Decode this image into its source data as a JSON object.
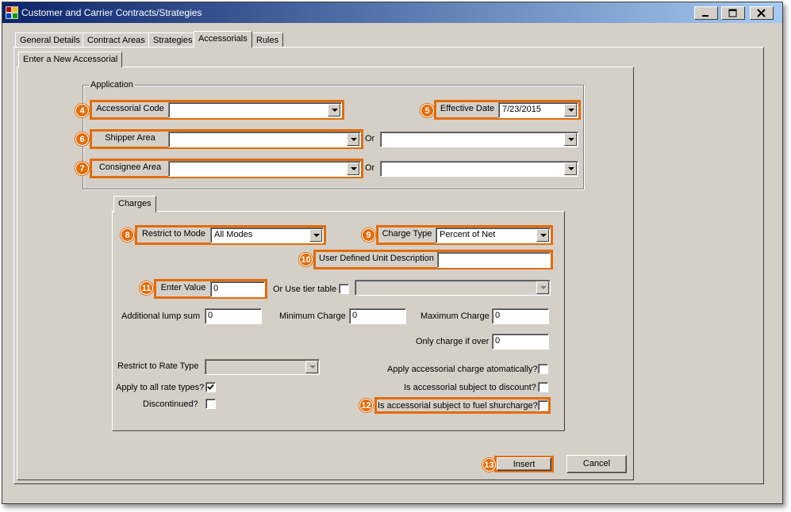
{
  "window": {
    "title": "Customer and Carrier Contracts/Strategies"
  },
  "tabs": [
    "General Details",
    "Contract Areas",
    "Strategies",
    "Accessorials",
    "Rules"
  ],
  "subtab": "Enter a New Accessorial",
  "application": {
    "legend": "Application",
    "accessorial_code_label": "Accessorial Code",
    "accessorial_code_value": "",
    "effective_date_label": "Effective Date",
    "effective_date_value": "7/23/2015",
    "shipper_area_label": "Shipper Area",
    "consignee_area_label": "Consignee Area",
    "or_label": "Or"
  },
  "charges": {
    "tab": "Charges",
    "restrict_mode_label": "Restrict to Mode",
    "restrict_mode_value": "All Modes",
    "charge_type_label": "Charge Type",
    "charge_type_value": "Percent of Net",
    "unit_desc_label": "User Defined Unit Description",
    "unit_desc_value": "",
    "enter_value_label": "Enter Value",
    "enter_value": "0",
    "tier_table_label": "Or Use tier table",
    "lump_sum_label": "Additional lump sum",
    "lump_sum_value": "0",
    "min_charge_label": "Minimum Charge",
    "min_charge_value": "0",
    "max_charge_label": "Maximum Charge",
    "max_charge_value": "0",
    "charge_if_over_label": "Only charge if over",
    "charge_if_over_value": "0",
    "rate_type_label": "Restrict to Rate Type",
    "auto_apply_label": "Apply accessorial charge atomatically?",
    "all_rate_types_label": "Apply to all rate types?",
    "discount_label": "Is accessorial subject to discount?",
    "discontinued_label": "Discontinued?",
    "fuel_label": "Is accessorial subject to fuel shurcharge?"
  },
  "buttons": {
    "insert": "Insert",
    "cancel": "Cancel"
  },
  "badges": [
    "4",
    "5",
    "6",
    "7",
    "8",
    "9",
    "10",
    "11",
    "12",
    "13"
  ],
  "colors": {
    "highlight": "#e36c0a",
    "titlebar": "#0a246a",
    "face": "#d4d0c8"
  },
  "icons": {
    "app": "app-icon",
    "minimize": "minimize-icon",
    "maximize": "maximize-icon",
    "close": "close-icon"
  }
}
